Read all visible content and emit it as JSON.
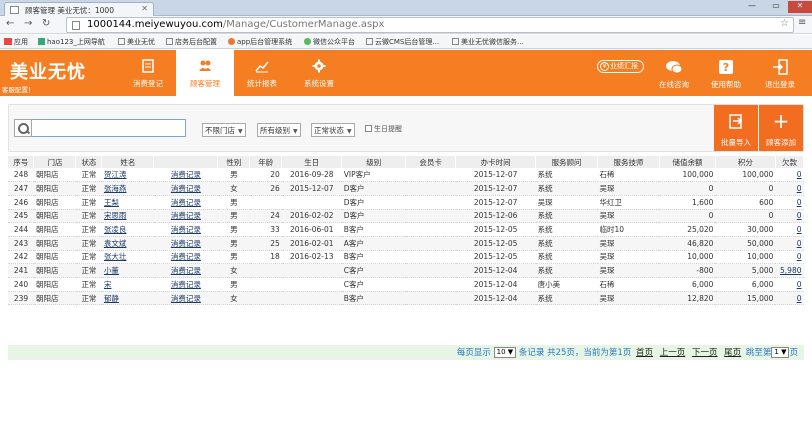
{
  "browser": {
    "tab_title": "顾客管理 美业无忧：1000",
    "url_domain": "1000144.meiyewuyou.com",
    "url_path": "/Manage/CustomerManage.aspx",
    "bookmarks": [
      "应用",
      "hao123_上网导航",
      "美业无忧",
      "店务后台配置",
      "app后台管理系统",
      "微信公众平台",
      "云微CMS后台管理...",
      "美业无忧微信服务..."
    ]
  },
  "header": {
    "logo": "美业无忧",
    "sublogo": "客服配置！",
    "nav": [
      {
        "label": "消费登记",
        "icon": "form-icon"
      },
      {
        "label": "顾客管理",
        "icon": "users-icon",
        "active": true
      },
      {
        "label": "统计报表",
        "icon": "chart-icon"
      },
      {
        "label": "系统设置",
        "icon": "gear-icon"
      }
    ],
    "perf_label": "业绩汇报",
    "perf_icon_text": "¥",
    "right_nav": [
      {
        "label": "在线咨询",
        "icon": "chat-icon"
      },
      {
        "label": "使用帮助",
        "icon": "help-icon"
      },
      {
        "label": "退出登录",
        "icon": "logout-icon"
      }
    ]
  },
  "filters": {
    "search_value": "",
    "store": "不限门店",
    "level": "所有级别",
    "status": "正常状态",
    "birthday_label": "生日提醒",
    "import_label": "批量导入",
    "add_label": "顾客添加"
  },
  "table": {
    "columns": [
      "序号",
      "门店",
      "状态",
      "姓名",
      "",
      "性别",
      "年龄",
      "生日",
      "级别",
      "会员卡",
      "办卡时间",
      "服务顾问",
      "服务技师",
      "储值余额",
      "积分",
      "欠款"
    ],
    "rows": [
      [
        "248",
        "朝阳店",
        "正常",
        "贺江涛",
        "消费记录",
        "男",
        "20",
        "2016-09-28",
        "VIP客户",
        "",
        "2015-12-07",
        "系统",
        "石稀",
        "100,000",
        "100,000",
        "0"
      ],
      [
        "247",
        "朝阳店",
        "正常",
        "张海燕",
        "消费记录",
        "女",
        "26",
        "2015-12-07",
        "D客户",
        "",
        "2015-12-07",
        "系统",
        "吴琛",
        "0",
        "0",
        "0"
      ],
      [
        "246",
        "朝阳店",
        "正常",
        "王梨",
        "消费记录",
        "男",
        "",
        "",
        "D客户",
        "",
        "2015-12-07",
        "吴琛",
        "华红卫",
        "1,600",
        "600",
        "0"
      ],
      [
        "245",
        "朝阳店",
        "正常",
        "宋思雨",
        "消费记录",
        "男",
        "24",
        "2016-02-02",
        "D客户",
        "",
        "2015-12-06",
        "系统",
        "吴琛",
        "0",
        "0",
        "0"
      ],
      [
        "244",
        "朝阳店",
        "正常",
        "张凌良",
        "消费记录",
        "男",
        "33",
        "2016-06-01",
        "B客户",
        "",
        "2015-12-05",
        "系统",
        "临时10",
        "25,020",
        "30,000",
        "0"
      ],
      [
        "243",
        "朝阳店",
        "正常",
        "袁文斌",
        "消费记录",
        "男",
        "25",
        "2016-02-01",
        "A客户",
        "",
        "2015-12-05",
        "系统",
        "吴琛",
        "46,820",
        "50,000",
        "0"
      ],
      [
        "242",
        "朝阳店",
        "正常",
        "张大壮",
        "消费记录",
        "男",
        "18",
        "2016-02-13",
        "B客户",
        "",
        "2015-12-05",
        "系统",
        "吴琛",
        "10,000",
        "10,000",
        "0"
      ],
      [
        "241",
        "朝阳店",
        "正常",
        "小董",
        "消费记录",
        "女",
        "",
        "",
        "C客户",
        "",
        "2015-12-04",
        "系统",
        "吴琛",
        "-800",
        "5,000",
        "5,980"
      ],
      [
        "240",
        "朝阳店",
        "正常",
        "宋",
        "消费记录",
        "男",
        "",
        "",
        "C客户",
        "",
        "2015-12-04",
        "唐小美",
        "石稀",
        "6,000",
        "6,000",
        "0"
      ],
      [
        "239",
        "朝阳店",
        "正常",
        "郁静",
        "消费记录",
        "女",
        "",
        "",
        "B客户",
        "",
        "2015-12-04",
        "系统",
        "吴琛",
        "12,820",
        "15,000",
        "0"
      ]
    ]
  },
  "pager": {
    "per_page_label": "每页显示",
    "per_page": "10",
    "records_label": "条记录",
    "summary": "共25页，当前为第1页",
    "first": "首页",
    "prev": "上一页",
    "next": "下一页",
    "last": "尾页",
    "jump_label": "跳至第",
    "jump_page": "1",
    "jump_suffix": "页"
  }
}
